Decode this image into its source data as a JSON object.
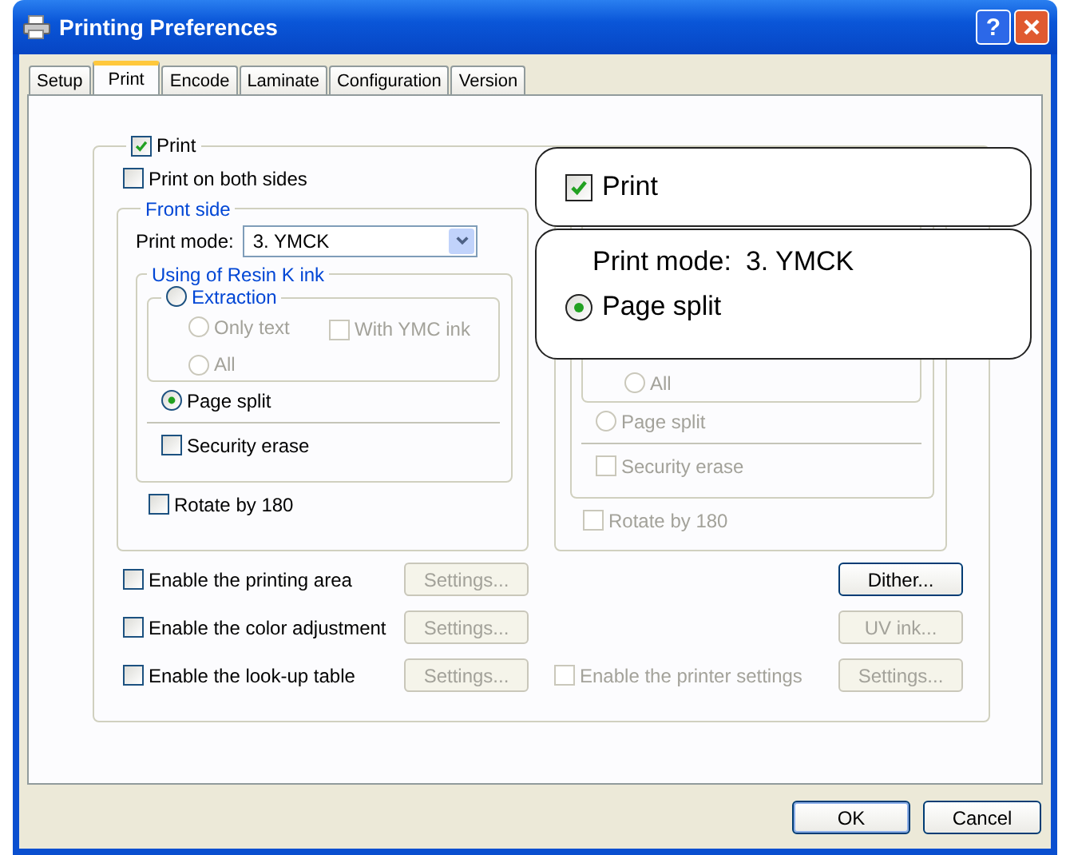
{
  "window": {
    "title": "Printing Preferences",
    "help": "?"
  },
  "tabs": [
    {
      "label": "Setup",
      "selected": false
    },
    {
      "label": "Print",
      "selected": true
    },
    {
      "label": "Encode",
      "selected": false
    },
    {
      "label": "Laminate",
      "selected": false
    },
    {
      "label": "Configuration",
      "selected": false
    },
    {
      "label": "Version",
      "selected": false
    }
  ],
  "print": {
    "label": "Print",
    "checked": true
  },
  "both_sides": {
    "label": "Print on both sides",
    "checked": false
  },
  "front_side": {
    "title": "Front side",
    "print_mode_label": "Print mode:",
    "print_mode": "3. YMCK",
    "resin_title": "Using of Resin K ink",
    "extraction": {
      "label": "Extraction",
      "selected": false,
      "disabled": false
    },
    "only_text": {
      "label": "Only text",
      "selected": false,
      "disabled": true
    },
    "with_ymc": {
      "label": "With YMC ink",
      "checked": false,
      "disabled": true
    },
    "all": {
      "label": "All",
      "selected": false,
      "disabled": true
    },
    "page_split": {
      "label": "Page split",
      "selected": true,
      "disabled": false
    },
    "security_erase": {
      "label": "Security erase",
      "checked": false,
      "disabled": false
    },
    "rotate": {
      "label": "Rotate by 180",
      "checked": false,
      "disabled": false
    }
  },
  "back_side": {
    "all": {
      "label": "All",
      "selected": false,
      "disabled": true
    },
    "page_split": {
      "label": "Page split",
      "selected": false,
      "disabled": true
    },
    "security_erase": {
      "label": "Security erase",
      "checked": false,
      "disabled": true
    },
    "rotate": {
      "label": "Rotate by 180",
      "checked": false,
      "disabled": true
    }
  },
  "options": [
    {
      "label": "Enable the printing area",
      "checked": false,
      "disabled": false,
      "button": "Settings...",
      "button_disabled": true
    },
    {
      "label": "Enable the color adjustment",
      "checked": false,
      "disabled": false,
      "button": "Settings...",
      "button_disabled": true
    },
    {
      "label": "Enable the look-up table",
      "checked": false,
      "disabled": false,
      "button": "Settings...",
      "button_disabled": true
    }
  ],
  "right_options": [
    {
      "kind": "button",
      "button": "Dither...",
      "button_disabled": false
    },
    {
      "kind": "button",
      "button": "UV ink...",
      "button_disabled": true
    },
    {
      "kind": "checkbox",
      "label": "Enable the printer settings",
      "checked": false,
      "disabled": true,
      "button": "Settings...",
      "button_disabled": true
    }
  ],
  "callouts": [
    {
      "print": {
        "label": "Print",
        "checked": true
      }
    },
    {
      "mode_label": "Print mode:",
      "mode_value": "3. YMCK",
      "page_split": {
        "label": "Page split",
        "selected": true
      }
    }
  ],
  "dialog_buttons": [
    {
      "label": "OK",
      "default": true
    },
    {
      "label": "Cancel",
      "default": false
    }
  ]
}
